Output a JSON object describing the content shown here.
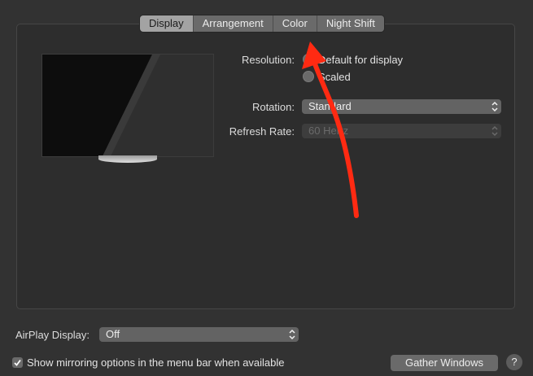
{
  "tabs": [
    {
      "label": "Display",
      "selected": true
    },
    {
      "label": "Arrangement",
      "selected": false
    },
    {
      "label": "Color",
      "selected": false
    },
    {
      "label": "Night Shift",
      "selected": false
    }
  ],
  "resolution": {
    "label": "Resolution:",
    "options": [
      "Default for display",
      "Scaled"
    ],
    "selected": "Default for display"
  },
  "rotation": {
    "label": "Rotation:",
    "value": "Standard"
  },
  "refresh_rate": {
    "label": "Refresh Rate:",
    "value": "60 Hertz",
    "disabled": true
  },
  "airplay": {
    "label": "AirPlay Display:",
    "value": "Off"
  },
  "mirroring": {
    "label": "Show mirroring options in the menu bar when available",
    "checked": true
  },
  "gather_windows_label": "Gather Windows",
  "help_label": "?",
  "colors": {
    "background": "#323232",
    "selected_tab": "#a3a3a3",
    "annotation_arrow": "#ff2a12"
  }
}
